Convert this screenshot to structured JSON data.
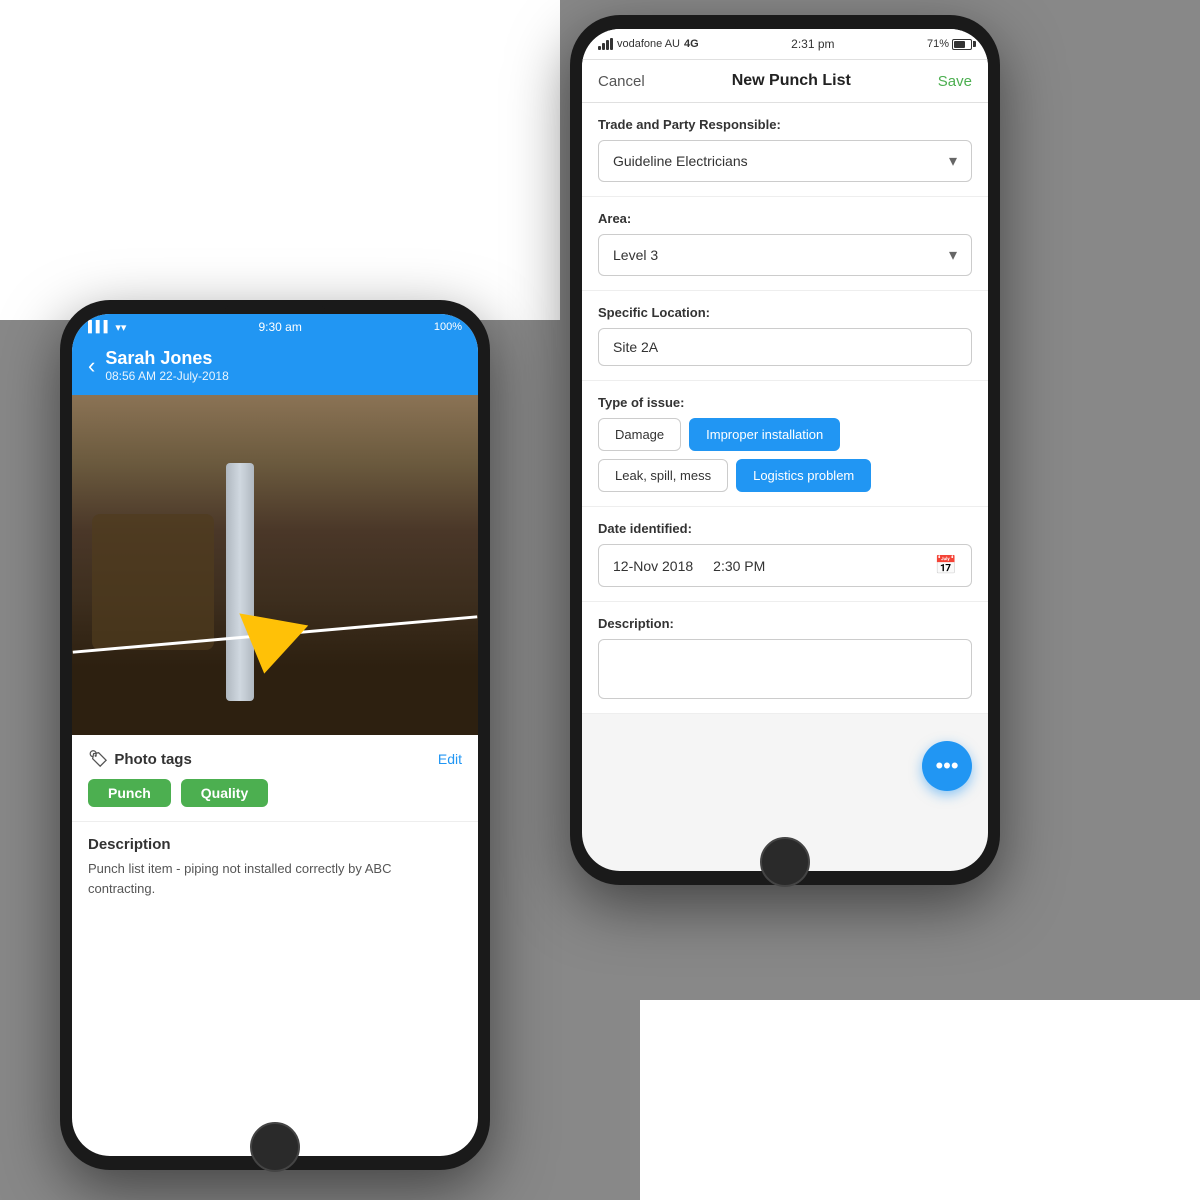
{
  "background": "#888888",
  "white_topleft": true,
  "white_bottomright": true,
  "phone_left": {
    "statusbar": {
      "signal": "▌▌▌",
      "wifi": "wifi",
      "time": "9:30 am",
      "battery": "100%"
    },
    "header": {
      "back": "‹",
      "username": "Sarah Jones",
      "datetime": "08:56 AM 22-July-2018"
    },
    "photo_tags": {
      "title": "Photo tags",
      "edit": "Edit",
      "tags": [
        "Punch",
        "Quality"
      ]
    },
    "description": {
      "title": "Description",
      "text": "Punch list item - piping not installed correctly by ABC contracting."
    }
  },
  "phone_right": {
    "statusbar": {
      "carrier": "vodafone AU",
      "network": "4G",
      "time": "2:31 pm",
      "battery_pct": "71%"
    },
    "header": {
      "cancel": "Cancel",
      "title": "New Punch List",
      "save": "Save"
    },
    "form": {
      "trade_label": "Trade and Party Responsible:",
      "trade_value": "Guideline Electricians",
      "area_label": "Area:",
      "area_value": "Level 3",
      "location_label": "Specific Location:",
      "location_value": "Site 2A",
      "issue_label": "Type of issue:",
      "issue_types": [
        {
          "label": "Damage",
          "active": false
        },
        {
          "label": "Improper installation",
          "active": true
        },
        {
          "label": "Leak, spill, mess",
          "active": false
        },
        {
          "label": "Logistics problem",
          "active": true
        }
      ],
      "date_label": "Date identified:",
      "date_value": "12-Nov 2018",
      "time_value": "2:30 PM",
      "description_label": "Description:",
      "description_placeholder": ""
    },
    "fab_label": "•••"
  }
}
